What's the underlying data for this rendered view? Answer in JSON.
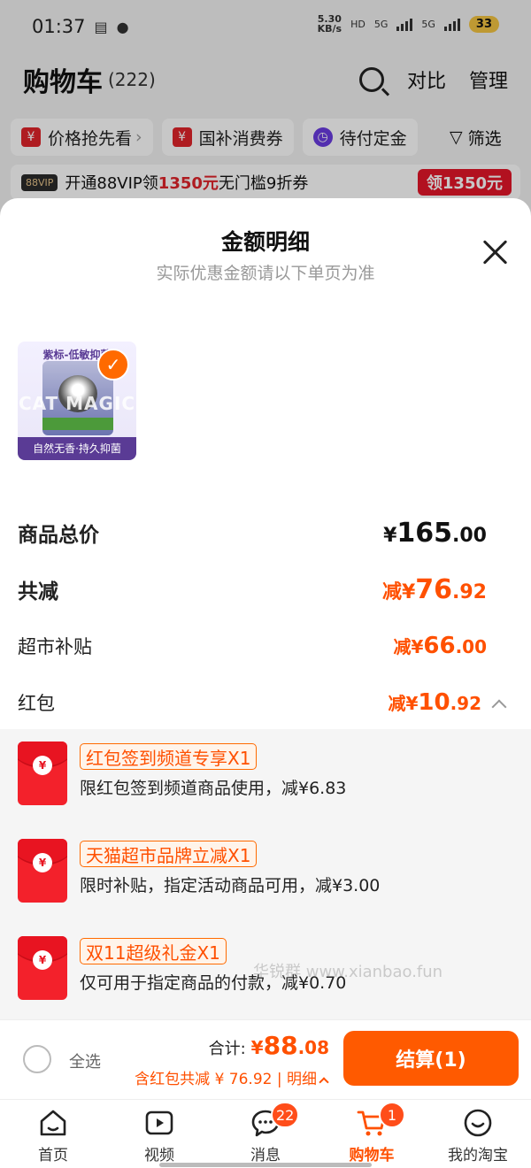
{
  "status_bar": {
    "time": "01:37",
    "net_speed_value": "5.30",
    "net_speed_unit": "KB/s",
    "signal_1": "5G",
    "signal_2": "5G",
    "battery": "33"
  },
  "cart_header": {
    "title": "购物车",
    "count": "(222)",
    "compare_label": "对比",
    "manage_label": "管理"
  },
  "chips": [
    {
      "label": "价格抢先看",
      "icon": "yen-tag-icon"
    },
    {
      "label": "国补消费券",
      "icon": "yen-tag-icon"
    },
    {
      "label": "待付定金",
      "icon": "clock-icon"
    }
  ],
  "filter_label": "筛选",
  "vip_banner": {
    "tag": "88VIP",
    "text_before": "开通88VIP领",
    "amount": "1350元",
    "text_after": "无门槛9折券",
    "button": "领1350元"
  },
  "sheet": {
    "title": "金额明细",
    "subtitle": "实际优惠金额请以下单页为准",
    "product": {
      "top_label": "紫标-低敏抑菌",
      "brand": "CAT MAGIC",
      "bottom_label": "自然无香·持久抑菌"
    },
    "total_price": {
      "label": "商品总价",
      "prefix": "¥",
      "int": "165",
      "dec": ".00"
    },
    "total_discount": {
      "label": "共减",
      "prefix": "减¥",
      "int": "76",
      "dec": ".92"
    },
    "supermarket_subsidy": {
      "label": "超市补贴",
      "prefix": "减¥",
      "int": "66",
      "dec": ".00"
    },
    "red_packet": {
      "label": "红包",
      "prefix": "减¥",
      "int": "10",
      "dec": ".92"
    },
    "coupons": [
      {
        "tag": "红包签到频道专享X1",
        "desc": "限红包签到频道商品使用，减¥6.83"
      },
      {
        "tag": "天猫超市品牌立减X1",
        "desc": "限时补贴，指定活动商品可用，减¥3.00"
      },
      {
        "tag": "双11超级礼金X1",
        "desc": "仅可用于指定商品的付款，减¥0.70"
      }
    ],
    "watermark": "华锐群 www.xianbao.fun"
  },
  "checkout": {
    "select_all": "全选",
    "total_label": "合计:",
    "total_prefix": "¥",
    "total_int": "88",
    "total_dec": ".08",
    "discount_text": "含红包共减 ¥ 76.92 | ",
    "detail_link": "明细",
    "button": "结算(1)"
  },
  "tabs": [
    {
      "label": "首页",
      "icon": "home-icon"
    },
    {
      "label": "视频",
      "icon": "video-icon"
    },
    {
      "label": "消息",
      "icon": "message-icon",
      "badge": "22"
    },
    {
      "label": "购物车",
      "icon": "cart-icon",
      "badge": "1",
      "active": true
    },
    {
      "label": "我的淘宝",
      "icon": "profile-icon"
    }
  ],
  "colors": {
    "accent": "#ff5000",
    "checkout_button": "#ff5a00",
    "red_packet": "#f3212b"
  }
}
